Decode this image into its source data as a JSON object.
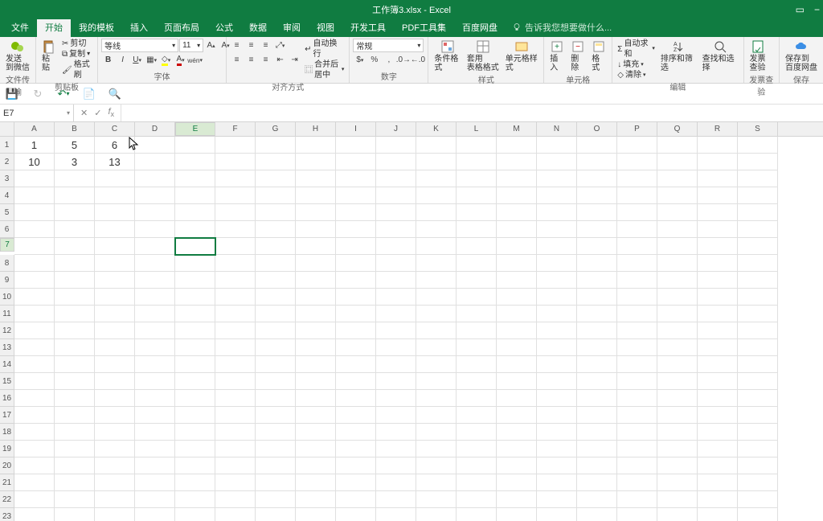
{
  "title": "工作簿3.xlsx - Excel",
  "menu": {
    "file": "文件",
    "tabs": [
      "开始",
      "我的模板",
      "插入",
      "页面布局",
      "公式",
      "数据",
      "审阅",
      "视图",
      "开发工具",
      "PDF工具集",
      "百度网盘"
    ],
    "active": "开始",
    "tell_me": "告诉我您想要做什么..."
  },
  "ribbon": {
    "wechat": {
      "label": "发送\n到微信",
      "group": "文件传输"
    },
    "clipboard": {
      "paste": "粘贴",
      "cut": "剪切",
      "copy": "复制",
      "format_painter": "格式刷",
      "group": "剪贴板"
    },
    "font": {
      "name": "等线",
      "size": "11",
      "group": "字体"
    },
    "alignment": {
      "wrap": "自动换行",
      "merge": "合并后居中",
      "group": "对齐方式"
    },
    "number": {
      "format": "常规",
      "group": "数字"
    },
    "styles": {
      "cond": "条件格式",
      "table": "套用\n表格格式",
      "cell": "单元格样式",
      "group": "样式"
    },
    "cells": {
      "insert": "插入",
      "delete": "删除",
      "format": "格式",
      "group": "单元格"
    },
    "editing": {
      "sum": "自动求和",
      "fill": "填充",
      "clear": "清除",
      "sort": "排序和筛选",
      "find": "查找和选择",
      "group": "编辑"
    },
    "invoice": {
      "label": "发票\n查验",
      "group": "发票查验"
    },
    "baidu": {
      "label": "保存到\n百度网盘",
      "group": "保存"
    }
  },
  "name_box": "E7",
  "columns": [
    "A",
    "B",
    "C",
    "D",
    "E",
    "F",
    "G",
    "H",
    "I",
    "J",
    "K",
    "L",
    "M",
    "N",
    "O",
    "P",
    "Q",
    "R",
    "S"
  ],
  "row_count": 23,
  "active_cell": {
    "col": "E",
    "row": 7
  },
  "cells": {
    "A1": "1",
    "B1": "5",
    "C1": "6",
    "A2": "10",
    "B2": "3",
    "C2": "13"
  },
  "chart_data": {
    "type": "table",
    "columns": [
      "A",
      "B",
      "C"
    ],
    "rows": [
      [
        1,
        5,
        6
      ],
      [
        10,
        3,
        13
      ]
    ]
  }
}
